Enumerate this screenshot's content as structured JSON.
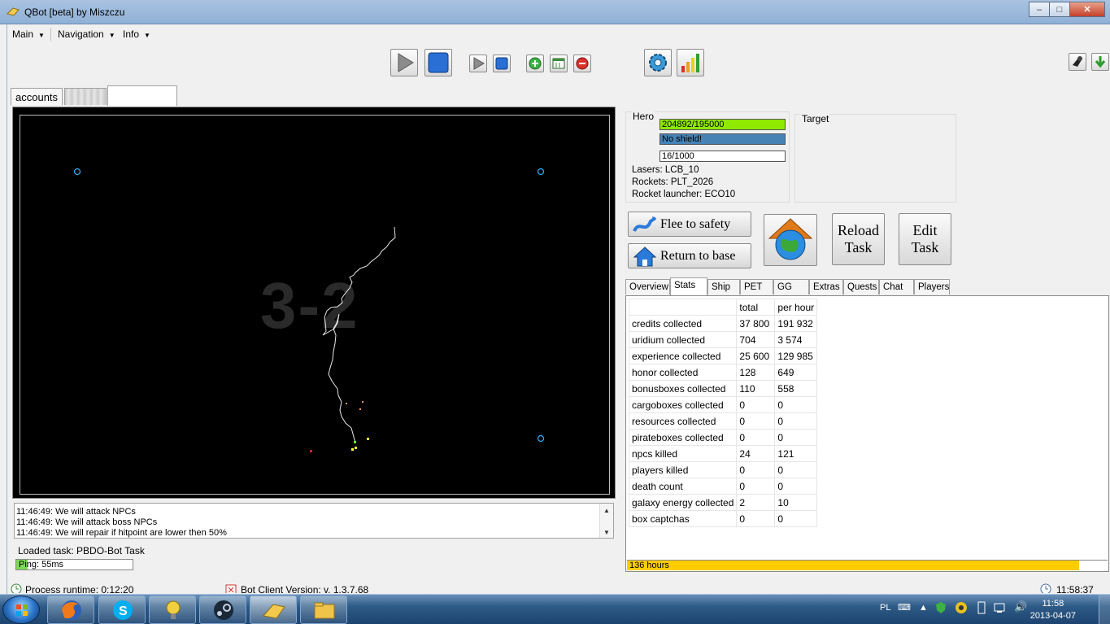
{
  "window": {
    "title": "QBot [beta] by Miszczu",
    "controls": [
      "minimize",
      "maximize",
      "close"
    ]
  },
  "menu": {
    "items": [
      {
        "label": "Main"
      },
      {
        "label": "Navigation"
      },
      {
        "label": "Info"
      }
    ]
  },
  "toolbar": {
    "buttons": [
      "play-large",
      "stop-large",
      "play-small",
      "stop-small",
      "add",
      "window",
      "remove",
      "settings",
      "statistics",
      "alien",
      "download"
    ]
  },
  "tabs": [
    {
      "label": "accounts"
    },
    {
      "label": ""
    },
    {
      "label": ""
    }
  ],
  "map": {
    "label": "3-2",
    "colors": {
      "background": "#000000",
      "portal": "#2ab1ff",
      "path": "#ffffff",
      "enemy": "#ff2020",
      "box": "#ffff33",
      "cargo": "#ff9a4a",
      "hero": "#66ff33"
    }
  },
  "log": {
    "lines": [
      "11:46:49: We will attack NPCs",
      "11:46:49: We will attack boss NPCs",
      "11:46:49: We will repair if hitpoint are lower then 50%"
    ]
  },
  "loaded_task": "Loaded task: PBDO-Bot Task",
  "ping": {
    "label": "Ping: 55ms",
    "fill": 0.1
  },
  "hero": {
    "title": "Hero",
    "hp": "204892/195000",
    "shield": "No shield!",
    "cargo": "16/1000",
    "lasers": "Lasers: LCB_10",
    "rockets": "Rockets: PLT_2026",
    "launcher": "Rocket launcher: ECO10",
    "colors": {
      "hp": "#8fe800",
      "shield": "#4682b4"
    }
  },
  "target": {
    "title": "Target"
  },
  "actions": {
    "flee": "Flee to safety",
    "return": "Return to base",
    "reload_line1": "Reload",
    "reload_line2": "Task",
    "edit_line1": "Edit",
    "edit_line2": "Task"
  },
  "stat_tabs": [
    {
      "label": "Overview"
    },
    {
      "label": "Stats"
    },
    {
      "label": "Ship"
    },
    {
      "label": "PET"
    },
    {
      "label": "GG"
    },
    {
      "label": "Extras"
    },
    {
      "label": "Quests"
    },
    {
      "label": "Chat"
    },
    {
      "label": "Players"
    }
  ],
  "stats": {
    "headers": [
      "",
      "total",
      "per hour"
    ],
    "rows": [
      [
        "credits collected",
        "37 800",
        "191 932"
      ],
      [
        "uridium collected",
        "704",
        "3 574"
      ],
      [
        "experience collected",
        "25 600",
        "129 985"
      ],
      [
        "honor collected",
        "128",
        "649"
      ],
      [
        "bonusboxes collected",
        "110",
        "558"
      ],
      [
        "cargoboxes collected",
        "0",
        "0"
      ],
      [
        "resources collected",
        "0",
        "0"
      ],
      [
        "pirateboxes collected",
        "0",
        "0"
      ],
      [
        "npcs killed",
        "24",
        "121"
      ],
      [
        "players killed",
        "0",
        "0"
      ],
      [
        "death count",
        "0",
        "0"
      ],
      [
        "galaxy energy collected",
        "2",
        "10"
      ],
      [
        "box captchas",
        "0",
        "0"
      ]
    ],
    "hours_label": "136 hours",
    "hours_fill": 0.94,
    "hours_color": "#ffcc00"
  },
  "status": {
    "runtime": "Process runtime:  0:12:20",
    "version": "Bot Client Version:  v. 1.3.7.68",
    "time": "11:58:37"
  },
  "taskbar": {
    "lang": "PL",
    "time": "11:58",
    "date": "2013-04-07"
  }
}
